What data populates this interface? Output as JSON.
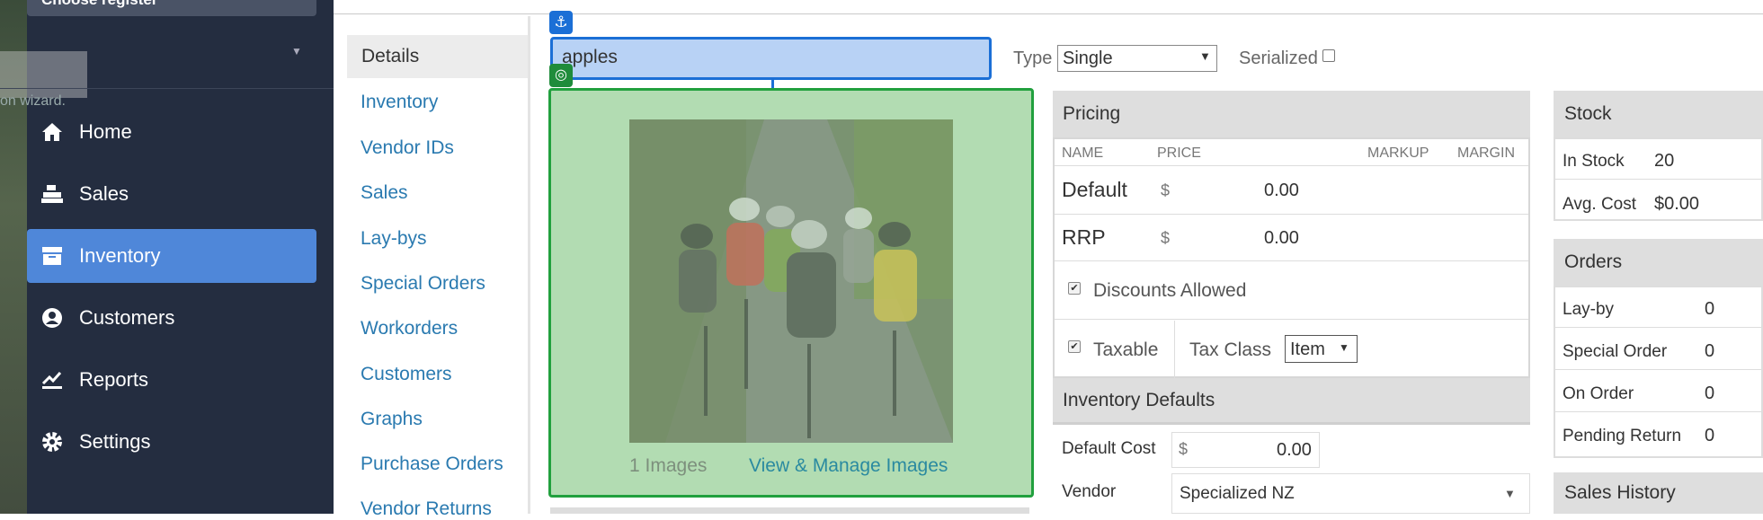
{
  "sidebar": {
    "register_label": "Choose register",
    "wizard_text": "on wizard.",
    "items": [
      {
        "label": "Home",
        "icon": "home-icon"
      },
      {
        "label": "Sales",
        "icon": "register-icon"
      },
      {
        "label": "Inventory",
        "icon": "inventory-icon",
        "active": true
      },
      {
        "label": "Customers",
        "icon": "customer-icon"
      },
      {
        "label": "Reports",
        "icon": "chart-icon"
      },
      {
        "label": "Settings",
        "icon": "gear-icon"
      }
    ]
  },
  "subnav": {
    "items": [
      "Details",
      "Inventory",
      "Vendor IDs",
      "Sales",
      "Lay-bys",
      "Special Orders",
      "Workorders",
      "Customers",
      "Graphs",
      "Purchase Orders",
      "Vendor Returns"
    ]
  },
  "item": {
    "name": "apples",
    "type_label": "Type",
    "type_value": "Single",
    "serialized_label": "Serialized"
  },
  "images": {
    "count_text": "1 Images",
    "manage_link": "View & Manage Images"
  },
  "pricing": {
    "title": "Pricing",
    "columns": [
      "NAME",
      "PRICE",
      "MARKUP",
      "MARGIN"
    ],
    "rows": [
      {
        "name": "Default",
        "currency": "$",
        "price": "0.00"
      },
      {
        "name": "RRP",
        "currency": "$",
        "price": "0.00"
      }
    ],
    "discounts_label": "Discounts Allowed",
    "taxable_label": "Taxable",
    "tax_class_label": "Tax Class",
    "tax_class_value": "Item"
  },
  "inventory_defaults": {
    "title": "Inventory Defaults",
    "default_cost_label": "Default Cost",
    "currency": "$",
    "default_cost": "0.00",
    "vendor_label": "Vendor",
    "vendor_value": "Specialized NZ"
  },
  "stock": {
    "title": "Stock",
    "in_stock_label": "In Stock",
    "in_stock_value": "20",
    "avg_cost_label": "Avg. Cost",
    "avg_cost_value": "$0.00"
  },
  "orders": {
    "title": "Orders",
    "rows": [
      {
        "label": "Lay-by",
        "value": "0"
      },
      {
        "label": "Special Order",
        "value": "0"
      },
      {
        "label": "On Order",
        "value": "0"
      },
      {
        "label": "Pending Return",
        "value": "0"
      }
    ]
  },
  "sales_history": {
    "title": "Sales History"
  },
  "colors": {
    "sidebar_bg": "#242d40",
    "active_nav": "#4f87d9",
    "selection_blue": "#1b6fd6",
    "selection_green": "#21a03e",
    "link": "#2a7ab0"
  }
}
